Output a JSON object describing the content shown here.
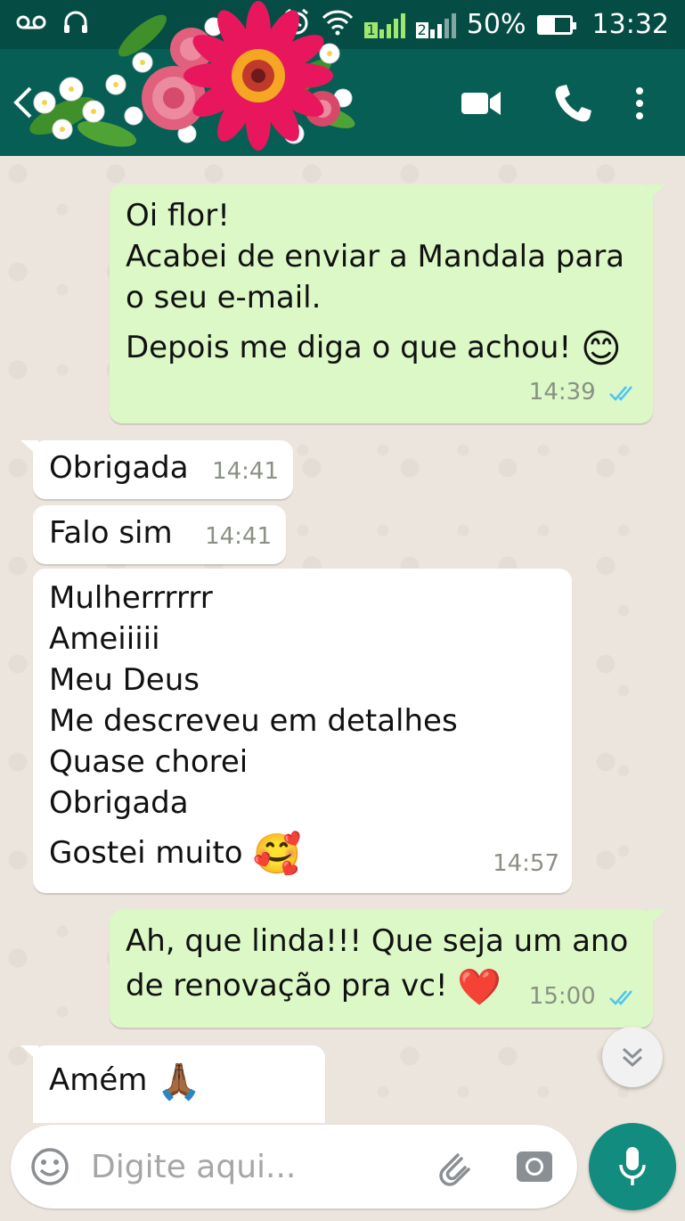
{
  "status_bar": {
    "battery": "50%",
    "battery_level": 0.5,
    "time": "13:32",
    "sim1": "1",
    "sim2": "2"
  },
  "header": {
    "icons": [
      "back-icon",
      "video-call-icon",
      "phone-icon",
      "more-options-icon"
    ],
    "accent": "#075e54",
    "status_bar_color": "#054d44"
  },
  "messages": [
    {
      "direction": "outgoing",
      "lines": [
        "Oi flor!",
        "Acabei de enviar a Mandala para",
        "o seu e-mail.",
        "Depois me diga o que achou!"
      ],
      "emoji": "😊",
      "time": "14:39",
      "status": "read"
    },
    {
      "direction": "incoming",
      "lines": [
        "Obrigada"
      ],
      "time": "14:41"
    },
    {
      "direction": "incoming",
      "lines": [
        "Falo sim"
      ],
      "time": "14:41"
    },
    {
      "direction": "incoming",
      "lines": [
        "Mulherrrrrr",
        "Ameiiiii",
        "Meu Deus",
        "Me descreveu em detalhes",
        "Quase chorei",
        "Obrigada",
        "Gostei muito"
      ],
      "emoji": "🥰",
      "time": "14:57"
    },
    {
      "direction": "outgoing",
      "lines": [
        "Ah, que linda!!! Que seja um ano",
        "de renovação pra vc!"
      ],
      "emoji": "❤️",
      "time": "15:00",
      "status": "read"
    },
    {
      "direction": "incoming",
      "lines": [
        "Amém"
      ],
      "emoji": "🙏🏾",
      "time": ""
    }
  ],
  "input": {
    "placeholder": "Digite aqui...",
    "value": ""
  },
  "colors": {
    "outgoing_bubble": "#dcf8c6",
    "incoming_bubble": "#ffffff",
    "chat_background": "#ece5dd",
    "tick_read": "#4fc3f7",
    "mic_button": "#128c7e"
  }
}
